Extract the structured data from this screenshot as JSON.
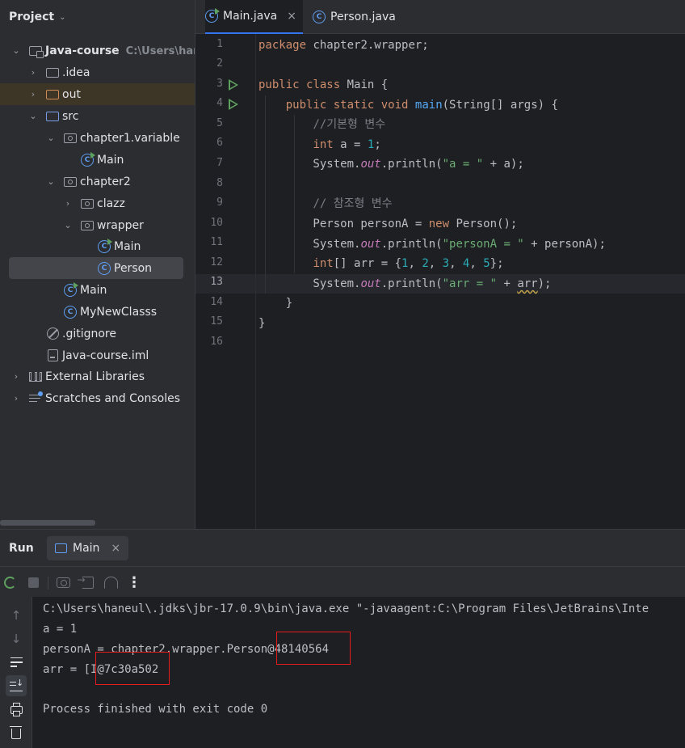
{
  "project": {
    "title": "Project",
    "tree": [
      {
        "label": "Java-course",
        "sub": "C:\\Users\\haneul",
        "icon": "project-folder-icon",
        "arrow": "down"
      },
      {
        "label": ".idea",
        "icon": "folder-icon",
        "arrow": "right"
      },
      {
        "label": "out",
        "icon": "folder-orange-icon",
        "arrow": "right"
      },
      {
        "label": "src",
        "icon": "folder-blue-icon",
        "arrow": "down"
      },
      {
        "label": "chapter1.variable",
        "icon": "package-icon",
        "arrow": "down"
      },
      {
        "label": "Main",
        "icon": "class-run-icon"
      },
      {
        "label": "chapter2",
        "icon": "package-icon",
        "arrow": "down"
      },
      {
        "label": "clazz",
        "icon": "package-icon",
        "arrow": "right"
      },
      {
        "label": "wrapper",
        "icon": "package-icon",
        "arrow": "down"
      },
      {
        "label": "Main",
        "icon": "class-run-icon"
      },
      {
        "label": "Person",
        "icon": "class-icon"
      },
      {
        "label": "Main",
        "icon": "class-run-icon"
      },
      {
        "label": "MyNewClasss",
        "icon": "class-icon"
      },
      {
        "label": ".gitignore",
        "icon": "gitignore-icon"
      },
      {
        "label": "Java-course.iml",
        "icon": "iml-file-icon"
      },
      {
        "label": "External Libraries",
        "icon": "libraries-icon",
        "arrow": "right"
      },
      {
        "label": "Scratches and Consoles",
        "icon": "scratches-icon",
        "arrow": "right"
      }
    ]
  },
  "editor": {
    "tabs": [
      {
        "label": "Main.java",
        "active": true
      },
      {
        "label": "Person.java",
        "active": false
      }
    ],
    "close_glyph": "×",
    "line_numbers": [
      "1",
      "2",
      "3",
      "4",
      "5",
      "6",
      "7",
      "8",
      "9",
      "10",
      "11",
      "12",
      "13",
      "14",
      "15",
      "16"
    ],
    "current_line": "13",
    "code": [
      "package chapter2.wrapper;",
      "",
      "public class Main {",
      "    public static void main(String[] args) {",
      "        //기본형 변수",
      "        int a = 1;",
      "        System.out.println(\"a = \" + a);",
      "",
      "        // 참조형 변수",
      "        Person personA = new Person();",
      "        System.out.println(\"personA = \" + personA);",
      "        int[] arr = {1, 2, 3, 4, 5};",
      "        System.out.println(\"arr = \" + arr);",
      "    }",
      "}",
      ""
    ]
  },
  "run": {
    "title": "Run",
    "tab_label": "Main",
    "close_glyph": "×",
    "more_glyph": "⋮",
    "output": [
      "C:\\Users\\haneul\\.jdks\\jbr-17.0.9\\bin\\java.exe \"-javaagent:C:\\Program Files\\JetBrains\\Inte",
      "a = 1",
      "personA = chapter2.wrapper.Person@48140564",
      "arr = [I@7c30a502",
      "",
      "Process finished with exit code 0"
    ]
  },
  "colors": {
    "keyword": "#cf8e6d",
    "function": "#56a8f5",
    "number": "#2aacb8",
    "string": "#6aab73",
    "comment": "#7a7e85",
    "static_field": "#c77dbb",
    "highlight_box": "#e81b1b",
    "accent": "#3574f0"
  }
}
